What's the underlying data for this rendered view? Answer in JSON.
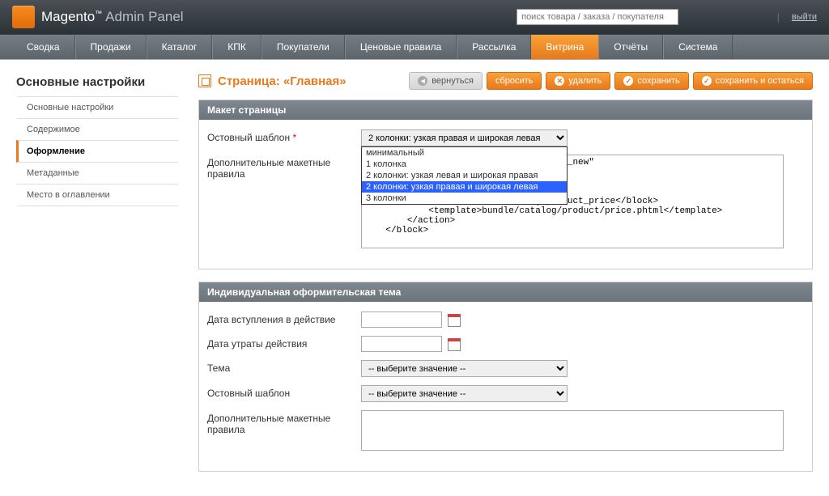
{
  "header": {
    "logo_main": "Magento",
    "logo_sub": "Admin Panel",
    "search_placeholder": "поиск товара / заказа / покупателя",
    "logout": "выйти"
  },
  "nav": [
    "Сводка",
    "Продажи",
    "Каталог",
    "КПК",
    "Покупатели",
    "Ценовые правила",
    "Рассылка",
    "Витрина",
    "Отчёты",
    "Система"
  ],
  "nav_active": 7,
  "sidebar": {
    "title": "Основные настройки",
    "items": [
      "Основные настройки",
      "Содержимое",
      "Оформление",
      "Метаданные",
      "Место в оглавлении"
    ],
    "active": 2
  },
  "page_title": "Страница: «Главная»",
  "actions": {
    "back": "вернуться",
    "reset": "сбросить",
    "delete": "удалить",
    "save": "сохранить",
    "save_stay": "сохранить и остаться"
  },
  "sections": {
    "layout": {
      "title": "Макет страницы",
      "template_label": "Остовный шаблон",
      "template_value": "2 колонки: узкая правая и широкая левая",
      "template_options": [
        "минимальный",
        "1 колонка",
        "2 колонки: узкая левая и широкая правая",
        "2 колонки: узкая правая и широкая левая",
        "3 колонки"
      ],
      "extra_label": "Дополнительные макетные правила",
      "extra_value": "me.catalog.product.new\" alias=\"product_new\"\nage\">\n\n            <type>bundle</type>\n            <block>bundle/catalog_product_price</block>\n            <template>bundle/catalog/product/price.phtml</template>\n        </action>\n    </block>"
    },
    "design": {
      "title": "Индивидуальная оформительская тема",
      "date_from_label": "Дата вступления в действие",
      "date_to_label": "Дата утраты действия",
      "theme_label": "Тема",
      "theme_placeholder": "-- выберите значение --",
      "template_label": "Остовный шаблон",
      "template_placeholder": "-- выберите значение --",
      "extra_label": "Дополнительные макетные правила"
    }
  }
}
